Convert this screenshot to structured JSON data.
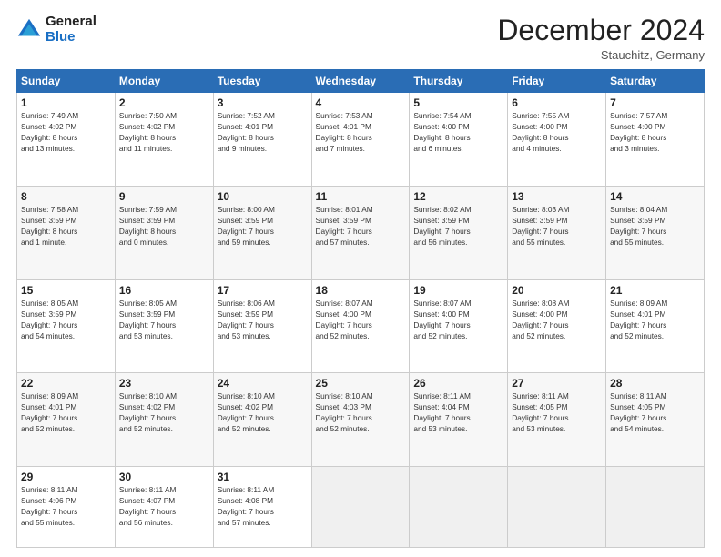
{
  "header": {
    "logo_line1": "General",
    "logo_line2": "Blue",
    "month": "December 2024",
    "location": "Stauchitz, Germany"
  },
  "weekdays": [
    "Sunday",
    "Monday",
    "Tuesday",
    "Wednesday",
    "Thursday",
    "Friday",
    "Saturday"
  ],
  "weeks": [
    [
      {
        "day": "1",
        "info": "Sunrise: 7:49 AM\nSunset: 4:02 PM\nDaylight: 8 hours\nand 13 minutes."
      },
      {
        "day": "2",
        "info": "Sunrise: 7:50 AM\nSunset: 4:02 PM\nDaylight: 8 hours\nand 11 minutes."
      },
      {
        "day": "3",
        "info": "Sunrise: 7:52 AM\nSunset: 4:01 PM\nDaylight: 8 hours\nand 9 minutes."
      },
      {
        "day": "4",
        "info": "Sunrise: 7:53 AM\nSunset: 4:01 PM\nDaylight: 8 hours\nand 7 minutes."
      },
      {
        "day": "5",
        "info": "Sunrise: 7:54 AM\nSunset: 4:00 PM\nDaylight: 8 hours\nand 6 minutes."
      },
      {
        "day": "6",
        "info": "Sunrise: 7:55 AM\nSunset: 4:00 PM\nDaylight: 8 hours\nand 4 minutes."
      },
      {
        "day": "7",
        "info": "Sunrise: 7:57 AM\nSunset: 4:00 PM\nDaylight: 8 hours\nand 3 minutes."
      }
    ],
    [
      {
        "day": "8",
        "info": "Sunrise: 7:58 AM\nSunset: 3:59 PM\nDaylight: 8 hours\nand 1 minute."
      },
      {
        "day": "9",
        "info": "Sunrise: 7:59 AM\nSunset: 3:59 PM\nDaylight: 8 hours\nand 0 minutes."
      },
      {
        "day": "10",
        "info": "Sunrise: 8:00 AM\nSunset: 3:59 PM\nDaylight: 7 hours\nand 59 minutes."
      },
      {
        "day": "11",
        "info": "Sunrise: 8:01 AM\nSunset: 3:59 PM\nDaylight: 7 hours\nand 57 minutes."
      },
      {
        "day": "12",
        "info": "Sunrise: 8:02 AM\nSunset: 3:59 PM\nDaylight: 7 hours\nand 56 minutes."
      },
      {
        "day": "13",
        "info": "Sunrise: 8:03 AM\nSunset: 3:59 PM\nDaylight: 7 hours\nand 55 minutes."
      },
      {
        "day": "14",
        "info": "Sunrise: 8:04 AM\nSunset: 3:59 PM\nDaylight: 7 hours\nand 55 minutes."
      }
    ],
    [
      {
        "day": "15",
        "info": "Sunrise: 8:05 AM\nSunset: 3:59 PM\nDaylight: 7 hours\nand 54 minutes."
      },
      {
        "day": "16",
        "info": "Sunrise: 8:05 AM\nSunset: 3:59 PM\nDaylight: 7 hours\nand 53 minutes."
      },
      {
        "day": "17",
        "info": "Sunrise: 8:06 AM\nSunset: 3:59 PM\nDaylight: 7 hours\nand 53 minutes."
      },
      {
        "day": "18",
        "info": "Sunrise: 8:07 AM\nSunset: 4:00 PM\nDaylight: 7 hours\nand 52 minutes."
      },
      {
        "day": "19",
        "info": "Sunrise: 8:07 AM\nSunset: 4:00 PM\nDaylight: 7 hours\nand 52 minutes."
      },
      {
        "day": "20",
        "info": "Sunrise: 8:08 AM\nSunset: 4:00 PM\nDaylight: 7 hours\nand 52 minutes."
      },
      {
        "day": "21",
        "info": "Sunrise: 8:09 AM\nSunset: 4:01 PM\nDaylight: 7 hours\nand 52 minutes."
      }
    ],
    [
      {
        "day": "22",
        "info": "Sunrise: 8:09 AM\nSunset: 4:01 PM\nDaylight: 7 hours\nand 52 minutes."
      },
      {
        "day": "23",
        "info": "Sunrise: 8:10 AM\nSunset: 4:02 PM\nDaylight: 7 hours\nand 52 minutes."
      },
      {
        "day": "24",
        "info": "Sunrise: 8:10 AM\nSunset: 4:02 PM\nDaylight: 7 hours\nand 52 minutes."
      },
      {
        "day": "25",
        "info": "Sunrise: 8:10 AM\nSunset: 4:03 PM\nDaylight: 7 hours\nand 52 minutes."
      },
      {
        "day": "26",
        "info": "Sunrise: 8:11 AM\nSunset: 4:04 PM\nDaylight: 7 hours\nand 53 minutes."
      },
      {
        "day": "27",
        "info": "Sunrise: 8:11 AM\nSunset: 4:05 PM\nDaylight: 7 hours\nand 53 minutes."
      },
      {
        "day": "28",
        "info": "Sunrise: 8:11 AM\nSunset: 4:05 PM\nDaylight: 7 hours\nand 54 minutes."
      }
    ],
    [
      {
        "day": "29",
        "info": "Sunrise: 8:11 AM\nSunset: 4:06 PM\nDaylight: 7 hours\nand 55 minutes."
      },
      {
        "day": "30",
        "info": "Sunrise: 8:11 AM\nSunset: 4:07 PM\nDaylight: 7 hours\nand 56 minutes."
      },
      {
        "day": "31",
        "info": "Sunrise: 8:11 AM\nSunset: 4:08 PM\nDaylight: 7 hours\nand 57 minutes."
      },
      {
        "day": "",
        "info": ""
      },
      {
        "day": "",
        "info": ""
      },
      {
        "day": "",
        "info": ""
      },
      {
        "day": "",
        "info": ""
      }
    ]
  ]
}
